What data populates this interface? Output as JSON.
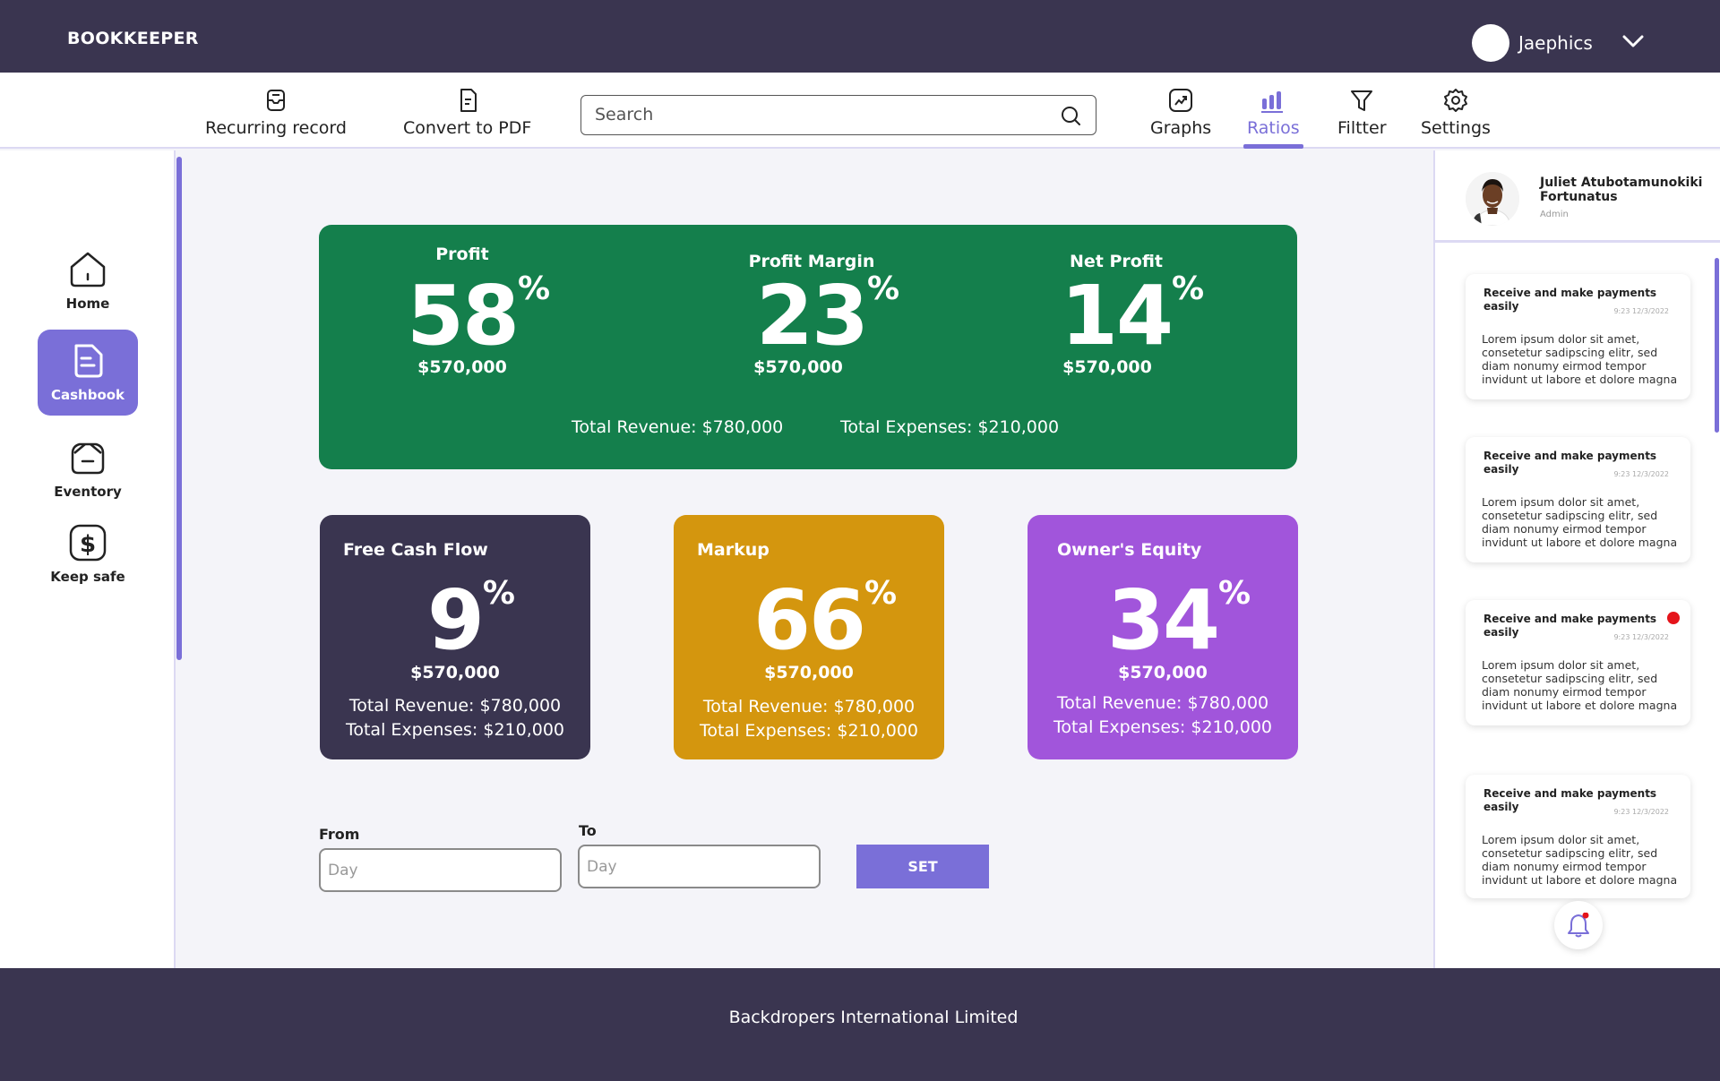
{
  "app": {
    "brand": "BOOKKEEPER"
  },
  "user": {
    "name": "Jaephics"
  },
  "toolbar": {
    "recurring_label": "Recurring record",
    "pdf_label": "Convert to PDF",
    "search_placeholder": "Search",
    "graphs_label": "Graphs",
    "ratios_label": "Ratios",
    "filter_label": "Filtter",
    "settings_label": "Settings",
    "active_tab": "Ratios"
  },
  "sidebar": {
    "items": [
      {
        "label": "Home",
        "icon": "home-icon"
      },
      {
        "label": "Cashbook",
        "icon": "document-icon",
        "active": true
      },
      {
        "label": "Eventory",
        "icon": "box-icon"
      },
      {
        "label": "Keep safe",
        "icon": "dollar-icon"
      }
    ]
  },
  "hero": {
    "color": "#147f4c",
    "metrics": [
      {
        "title": "Profit",
        "value": "58",
        "unit": "%",
        "amount": "$570,000"
      },
      {
        "title": "Profit Margin",
        "value": "23",
        "unit": "%",
        "amount": "$570,000"
      },
      {
        "title": "Net Profit",
        "value": "14",
        "unit": "%",
        "amount": "$570,000"
      }
    ],
    "total_revenue": "Total Revenue: $780,000",
    "total_expenses": "Total Expenses: $210,000"
  },
  "cards": [
    {
      "title": "Free Cash Flow",
      "value": "9",
      "unit": "%",
      "amount": "$570,000",
      "total_revenue": "Total Revenue: $780,000",
      "total_expenses": "Total Expenses: $210,000",
      "color": "#3a3550"
    },
    {
      "title": "Markup",
      "value": "66",
      "unit": "%",
      "amount": "$570,000",
      "total_revenue": "Total Revenue: $780,000",
      "total_expenses": "Total Expenses: $210,000",
      "color": "#d4960e"
    },
    {
      "title": "Owner's Equity",
      "value": "34",
      "unit": "%",
      "amount": "$570,000",
      "total_revenue": "Total Revenue: $780,000",
      "total_expenses": "Total Expenses: $210,000",
      "color": "#a155db"
    }
  ],
  "date_filter": {
    "from_label": "From",
    "to_label": "To",
    "from_placeholder": "Day",
    "to_placeholder": "Day",
    "set_label": "SET"
  },
  "profile": {
    "name": "Juliet Atubotamunokiki Fortunatus",
    "role": "Admin"
  },
  "notifications": [
    {
      "title": "Receive and make payments easily",
      "time": "9:23  12/3/2022",
      "body": "Lorem ipsum dolor sit amet, consetetur sadipscing elitr, sed diam nonumy eirmod tempor invidunt ut labore et dolore magna",
      "unread": false
    },
    {
      "title": "Receive and make payments easily",
      "time": "9:23  12/3/2022",
      "body": "Lorem ipsum dolor sit amet, consetetur sadipscing elitr, sed diam nonumy eirmod tempor invidunt ut labore et dolore magna",
      "unread": false
    },
    {
      "title": "Receive and make payments easily",
      "time": "9:23  12/3/2022",
      "body": "Lorem ipsum dolor sit amet, consetetur sadipscing elitr, sed diam nonumy eirmod tempor invidunt ut labore et dolore magna",
      "unread": true
    },
    {
      "title": "Receive and make payments easily",
      "time": "9:23  12/3/2022",
      "body": "Lorem ipsum dolor sit amet, consetetur sadipscing elitr, sed diam nonumy eirmod tempor invidunt ut labore et dolore magna",
      "unread": false
    }
  ],
  "footer": {
    "text": "Backdropers International Limited"
  },
  "colors": {
    "accent": "#7a6fd8",
    "bar": "#3a3550",
    "unread_dot": "#e5141b"
  }
}
